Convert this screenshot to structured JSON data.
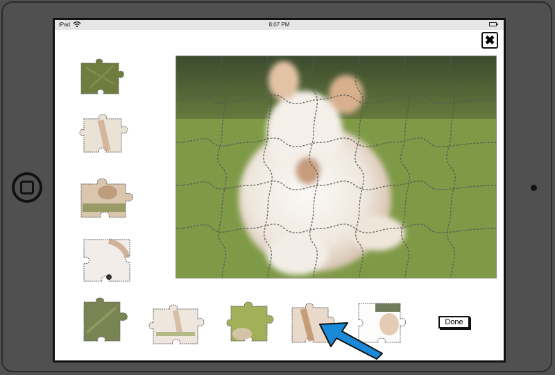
{
  "status_bar": {
    "carrier": "iPad",
    "time": "8:07 PM",
    "wifi_icon": "wifi-icon",
    "battery_icon": "battery-icon"
  },
  "close_button": {
    "label": "✖",
    "icon": "close-icon"
  },
  "board": {
    "image_subject": "white calf lying in grass",
    "pieces_placed": true
  },
  "side_pieces": [
    {
      "id": "piece-left-1",
      "colors": [
        "#6e7a3e",
        "#8a8c55"
      ]
    },
    {
      "id": "piece-left-2",
      "colors": [
        "#e9dfd2",
        "#c49a76"
      ]
    },
    {
      "id": "piece-left-3",
      "colors": [
        "#d8c2a8",
        "#7f8a4a"
      ]
    },
    {
      "id": "piece-left-4",
      "colors": [
        "#f1ebe6",
        "#b88a66"
      ]
    }
  ],
  "tray_pieces": [
    {
      "id": "piece-tray-1",
      "colors": [
        "#7a8550",
        "#a2a56a"
      ]
    },
    {
      "id": "piece-tray-2",
      "colors": [
        "#efe5dc",
        "#c8a582"
      ]
    },
    {
      "id": "piece-tray-3",
      "colors": [
        "#a5b35a",
        "#d7c7ac"
      ]
    },
    {
      "id": "piece-tray-4",
      "colors": [
        "#e7d8c9",
        "#b98557"
      ]
    },
    {
      "id": "piece-tray-5",
      "colors": [
        "#ffffff",
        "#d7b695"
      ]
    }
  ],
  "cursor": {
    "color": "#1a8ad8",
    "icon": "arrow-pointer-icon"
  },
  "done_button": {
    "label": "Done"
  }
}
